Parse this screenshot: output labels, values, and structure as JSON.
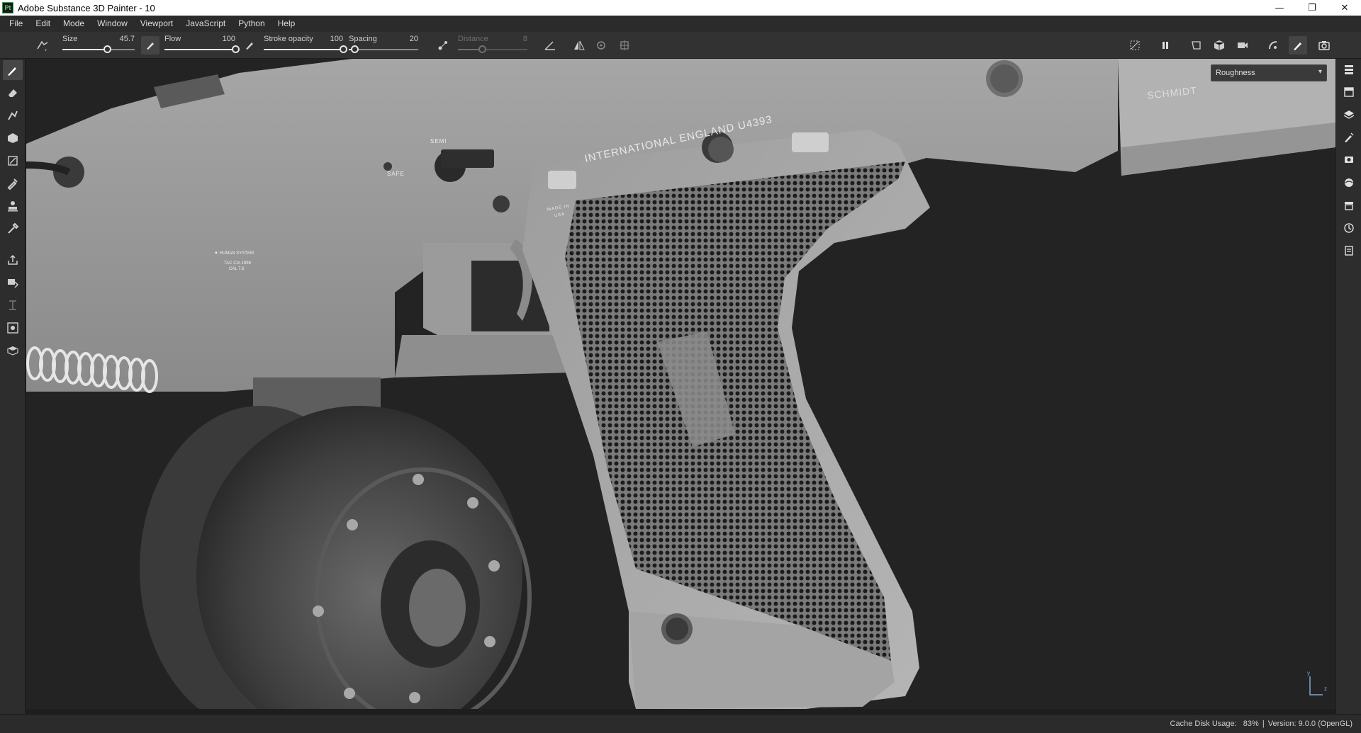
{
  "window": {
    "app_icon_text": "Pt",
    "title": "Adobe Substance 3D Painter - 10",
    "minimize": "—",
    "restore": "❐",
    "close": "✕"
  },
  "menu": [
    "File",
    "Edit",
    "Mode",
    "Window",
    "Viewport",
    "JavaScript",
    "Python",
    "Help"
  ],
  "toolbar": {
    "size": {
      "label": "Size",
      "value": "45.7",
      "level": 0.62
    },
    "flow": {
      "label": "Flow",
      "value": "100",
      "level": 1.0
    },
    "stroke_opacity": {
      "label": "Stroke opacity",
      "value": "100",
      "level": 1.0
    },
    "spacing": {
      "label": "Spacing",
      "value": "20",
      "level": 0.08
    },
    "distance": {
      "label": "Distance",
      "value": "8",
      "level": 0.35,
      "disabled": true
    }
  },
  "viewport": {
    "channel": "Roughness",
    "engravings": {
      "serial": "INTERNATIONAL ENGLAND U4393",
      "brand": "SCHMIDT",
      "semi": "SEMI",
      "safe": "SAFE",
      "made_in": "MADE IN",
      "made_in_country": "USA",
      "system": "▼ HUMAN SYSTEM",
      "caliber_line1": "TAC CIA 1998",
      "caliber_line2": "CAL 7.6"
    },
    "axis": {
      "x": "z",
      "y": "y"
    }
  },
  "status": {
    "cache_label": "Cache Disk Usage:",
    "cache_value": "83%",
    "separator": "|",
    "version": "Version: 9.0.0 (OpenGL)"
  },
  "colors": {
    "accent": "#ffffff",
    "panel": "#2d2d2d",
    "viewport_bg": "#232323",
    "logo_green": "#62d26f"
  }
}
